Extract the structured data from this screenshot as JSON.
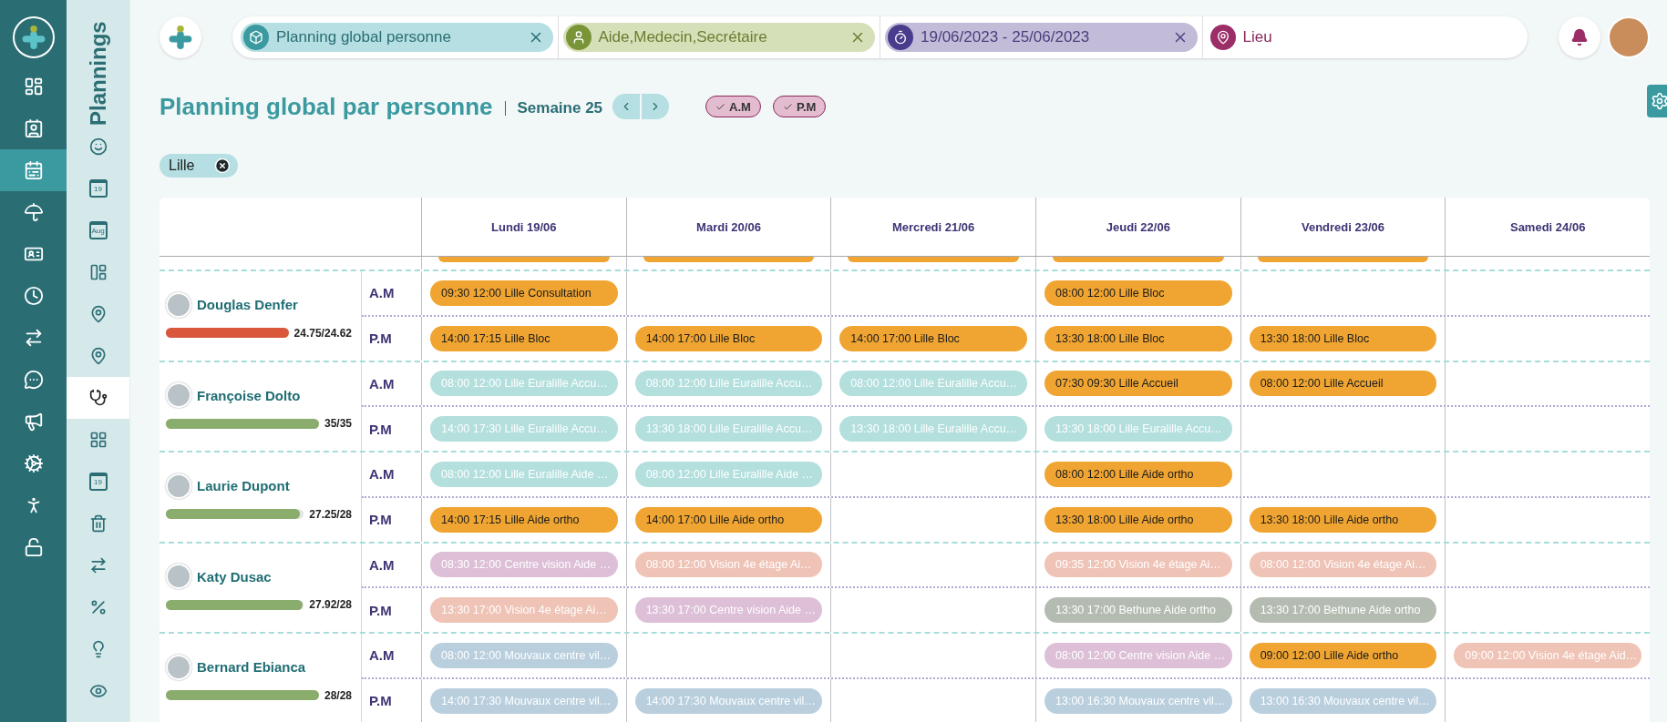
{
  "main_nav": {
    "items": [
      {
        "selected": false
      },
      {
        "selected": false
      },
      {
        "selected": true
      },
      {
        "selected": false
      },
      {
        "selected": false
      },
      {
        "selected": false
      },
      {
        "selected": false
      },
      {
        "selected": false
      },
      {
        "selected": false
      },
      {
        "selected": false
      },
      {
        "selected": false
      },
      {
        "selected": false
      }
    ]
  },
  "sub_nav": {
    "title": "Plannings",
    "items": [
      {
        "kind": "icon",
        "selected": false
      },
      {
        "kind": "calendar",
        "label": "19",
        "selected": false
      },
      {
        "kind": "calendar",
        "label": "Aug",
        "selected": false
      },
      {
        "kind": "icon",
        "selected": false
      },
      {
        "kind": "icon",
        "selected": false
      },
      {
        "kind": "icon",
        "selected": false
      },
      {
        "kind": "icon",
        "selected": true
      },
      {
        "kind": "icon",
        "selected": false
      },
      {
        "kind": "calendar",
        "label": "19",
        "selected": false
      },
      {
        "kind": "icon",
        "selected": false
      },
      {
        "kind": "icon",
        "selected": false
      },
      {
        "kind": "icon",
        "selected": false
      },
      {
        "kind": "icon",
        "selected": false
      },
      {
        "kind": "icon",
        "selected": false
      }
    ]
  },
  "filters": [
    {
      "label": "Planning global personne",
      "color": "#3a9aa0",
      "removable": true
    },
    {
      "label": "Aide,Medecin,Secrétaire",
      "color": "#7a9438",
      "removable": true
    },
    {
      "label": "19/06/2023 - 25/06/2023",
      "color": "#4a3c8c",
      "removable": true
    },
    {
      "label": "Lieu",
      "color": "#9b2d67",
      "removable": false
    }
  ],
  "page": {
    "title": "Planning global par personne",
    "week": "Semaine 25",
    "toggles": [
      {
        "label": "A.M",
        "checked": true
      },
      {
        "label": "P.M",
        "checked": true
      }
    ],
    "location_chip": "Lille"
  },
  "table": {
    "days": [
      {
        "label": "Lundi 19/06",
        "cut_event": true
      },
      {
        "label": "Mardi 20/06",
        "cut_event": true
      },
      {
        "label": "Mercredi 21/06",
        "cut_event": true
      },
      {
        "label": "Jeudi 22/06",
        "cut_event": true
      },
      {
        "label": "Vendredi 23/06",
        "cut_event": true
      },
      {
        "label": "Samedi 24/06",
        "cut_event": false
      }
    ],
    "persons": [
      {
        "name": "Douglas Denfer",
        "hours": "24.75/24.62",
        "level": 1,
        "color": "#d9573b",
        "slots": [
          {
            "label": "A.M",
            "cells": [
              {
                "kind": "event",
                "text": "09:30 12:00 Lille Consultation",
                "color": "#f0a532",
                "muted": false
              },
              {
                "kind": "empty"
              },
              {
                "kind": "empty"
              },
              {
                "kind": "event",
                "text": "08:00 12:00 Lille Bloc",
                "color": "#f0a532",
                "muted": false
              },
              {
                "kind": "empty"
              },
              {
                "kind": "empty"
              }
            ]
          },
          {
            "label": "P.M",
            "cells": [
              {
                "kind": "event",
                "text": "14:00 17:15 Lille Bloc",
                "color": "#f0a532",
                "muted": false
              },
              {
                "kind": "event",
                "text": "14:00 17:00 Lille Bloc",
                "color": "#f0a532",
                "muted": false
              },
              {
                "kind": "event",
                "text": "14:00 17:00 Lille Bloc",
                "color": "#f0a532",
                "muted": false
              },
              {
                "kind": "event",
                "text": "13:30 18:00 Lille Bloc",
                "color": "#f0a532",
                "muted": false
              },
              {
                "kind": "event",
                "text": "13:30 18:00 Lille Bloc",
                "color": "#f0a532",
                "muted": false
              },
              {
                "kind": "empty"
              }
            ]
          }
        ]
      },
      {
        "name": "Françoise Dolto",
        "hours": "35/35",
        "level": 1,
        "color": "#8aad6e",
        "slots": [
          {
            "label": "A.M",
            "cells": [
              {
                "kind": "event",
                "text": "08:00 12:00 Lille Euralille Accu…",
                "color": "#b3dfdd",
                "muted": true
              },
              {
                "kind": "event",
                "text": "08:00 12:00 Lille Euralille Accu…",
                "color": "#b3dfdd",
                "muted": true
              },
              {
                "kind": "event",
                "text": "08:00 12:00 Lille Euralille Accu…",
                "color": "#b3dfdd",
                "muted": true
              },
              {
                "kind": "event",
                "text": "07:30 09:30 Lille Accueil",
                "color": "#f0a532",
                "muted": false
              },
              {
                "kind": "event",
                "text": "08:00 12:00 Lille Accueil",
                "color": "#f0a532",
                "muted": false
              },
              {
                "kind": "empty"
              }
            ]
          },
          {
            "label": "P.M",
            "cells": [
              {
                "kind": "event",
                "text": "14:00 17:30 Lille Euralille Accu…",
                "color": "#b3dfdd",
                "muted": true
              },
              {
                "kind": "event",
                "text": "13:30 18:00 Lille Euralille Accu…",
                "color": "#b3dfdd",
                "muted": true
              },
              {
                "kind": "event",
                "text": "13:30 18:00 Lille Euralille Accu…",
                "color": "#b3dfdd",
                "muted": true
              },
              {
                "kind": "event",
                "text": "13:30 18:00 Lille Euralille Accu…",
                "color": "#b3dfdd",
                "muted": true
              },
              {
                "kind": "empty"
              },
              {
                "kind": "empty"
              }
            ]
          }
        ]
      },
      {
        "name": "Laurie Dupont",
        "hours": "27.25/28",
        "level": 0.97,
        "color": "#8aad6e",
        "slots": [
          {
            "label": "A.M",
            "cells": [
              {
                "kind": "event",
                "text": "08:00 12:00 Lille Euralille Aide …",
                "color": "#b3dfdd",
                "muted": true
              },
              {
                "kind": "event",
                "text": "08:00 12:00 Lille Euralille Aide …",
                "color": "#b3dfdd",
                "muted": true
              },
              {
                "kind": "empty"
              },
              {
                "kind": "event",
                "text": "08:00 12:00 Lille Aide ortho",
                "color": "#f0a532",
                "muted": false
              },
              {
                "kind": "empty"
              },
              {
                "kind": "empty"
              }
            ]
          },
          {
            "label": "P.M",
            "cells": [
              {
                "kind": "event",
                "text": "14:00 17:15 Lille Aide ortho",
                "color": "#f0a532",
                "muted": false
              },
              {
                "kind": "event",
                "text": "14:00 17:00 Lille Aide ortho",
                "color": "#f0a532",
                "muted": false
              },
              {
                "kind": "empty"
              },
              {
                "kind": "event",
                "text": "13:30 18:00 Lille Aide ortho",
                "color": "#f0a532",
                "muted": false
              },
              {
                "kind": "event",
                "text": "13:30 18:00 Lille Aide ortho",
                "color": "#f0a532",
                "muted": false
              },
              {
                "kind": "empty"
              }
            ]
          }
        ]
      },
      {
        "name": "Katy Dusac",
        "hours": "27.92/28",
        "level": 0.99,
        "color": "#8aad6e",
        "slots": [
          {
            "label": "A.M",
            "cells": [
              {
                "kind": "event",
                "text": "08:30 12:00 Centre vision Aide …",
                "color": "#ddbfd7",
                "muted": true
              },
              {
                "kind": "event",
                "text": "08:00 12:00 Vision 4e étage Ai…",
                "color": "#efc3b6",
                "muted": true
              },
              {
                "kind": "empty"
              },
              {
                "kind": "event",
                "text": "09:35 12:00 Vision 4e étage Ai…",
                "color": "#efc3b6",
                "muted": true
              },
              {
                "kind": "event",
                "text": "08:00 12:00 Vision 4e étage Ai…",
                "color": "#efc3b6",
                "muted": true
              },
              {
                "kind": "empty"
              }
            ]
          },
          {
            "label": "P.M",
            "cells": [
              {
                "kind": "event",
                "text": "13:30 17:00 Vision 4e étage Ai…",
                "color": "#efc3b6",
                "muted": true
              },
              {
                "kind": "event",
                "text": "13:30 17:00 Centre vision Aide …",
                "color": "#ddbfd7",
                "muted": true
              },
              {
                "kind": "empty"
              },
              {
                "kind": "event",
                "text": "13:30 17:00 Bethune Aide ortho",
                "color": "#b4bcb1",
                "muted": true
              },
              {
                "kind": "event",
                "text": "13:30 17:00 Bethune Aide ortho",
                "color": "#b4bcb1",
                "muted": true
              },
              {
                "kind": "empty"
              }
            ]
          }
        ]
      },
      {
        "name": "Bernard Ebianca",
        "hours": "28/28",
        "level": 1,
        "color": "#8aad6e",
        "slots": [
          {
            "label": "A.M",
            "cells": [
              {
                "kind": "event",
                "text": "08:00 12:00 Mouvaux centre vil…",
                "color": "#b9cfdd",
                "muted": true
              },
              {
                "kind": "empty"
              },
              {
                "kind": "empty"
              },
              {
                "kind": "event",
                "text": "08:00 12:00 Centre vision Aide …",
                "color": "#ddbfd7",
                "muted": true
              },
              {
                "kind": "event",
                "text": "09:00 12:00 Lille Aide ortho",
                "color": "#f0a532",
                "muted": false
              },
              {
                "kind": "event",
                "text": "09:00 12:00 Vision 4e étage Aid…",
                "color": "#efc3b6",
                "muted": true
              }
            ]
          },
          {
            "label": "P.M",
            "cells": [
              {
                "kind": "event",
                "text": "14:00 17:30 Mouvaux centre vil…",
                "color": "#b9cfdd",
                "muted": true
              },
              {
                "kind": "event",
                "text": "14:00 17:30 Mouvaux centre vil…",
                "color": "#b9cfdd",
                "muted": true
              },
              {
                "kind": "empty"
              },
              {
                "kind": "event",
                "text": "13:00 16:30 Mouvaux centre vil…",
                "color": "#b9cfdd",
                "muted": true
              },
              {
                "kind": "event",
                "text": "13:00 16:30 Mouvaux centre vil…",
                "color": "#b9cfdd",
                "muted": true
              },
              {
                "kind": "empty"
              }
            ]
          }
        ]
      }
    ]
  }
}
